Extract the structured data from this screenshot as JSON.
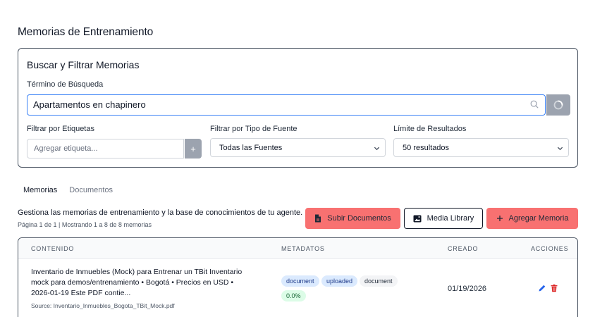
{
  "page_title": "Memorias de Entrenamiento",
  "search_card": {
    "title": "Buscar y Filtrar Memorias",
    "search_label": "Término de Búsqueda",
    "search_value": "Apartamentos en chapinero",
    "tags_label": "Filtrar por Etiquetas",
    "tags_placeholder": "Agregar etiqueta...",
    "tags_add": "+",
    "source_label": "Filtrar por Tipo de Fuente",
    "source_value": "Todas las Fuentes",
    "limit_label": "Límite de Resultados",
    "limit_value": "50 resultados"
  },
  "tabs": [
    "Memorias",
    "Documentos"
  ],
  "description": "Gestiona las memorias de entrenamiento y la base de conocimientos de tu agente.",
  "pagination": "Página 1 de 1 | Mostrando 1 a 8 de 8 memorias",
  "buttons": {
    "upload": "Subir Documentos",
    "media": "Media Library",
    "add": "Agregar Memoria"
  },
  "table": {
    "headers": [
      "CONTENIDO",
      "METADATOS",
      "CREADO",
      "ACCIONES"
    ],
    "rows": [
      {
        "content": "Inventario de Inmuebles (Mock) para Entrenar un TBit Inventario mock para demos/entrenamiento • Bogotá • Precios en USD • 2026-01-19 Este PDF contie...",
        "source": "Source: Inventario_Inmuebles_Bogota_TBit_Mock.pdf",
        "badges": [
          "document",
          "uploaded",
          "document",
          "0.0%"
        ],
        "created": "01/19/2026"
      }
    ]
  },
  "colors": {
    "accent_blue": "#3b82f6",
    "button_red": "#f87171",
    "edit_blue": "#2563eb",
    "delete_red": "#dc2626"
  },
  "icons": [
    "search-icon",
    "spinner-icon",
    "chevron-down-icon",
    "document-icon",
    "image-icon",
    "plus-icon",
    "pencil-icon",
    "trash-icon"
  ]
}
